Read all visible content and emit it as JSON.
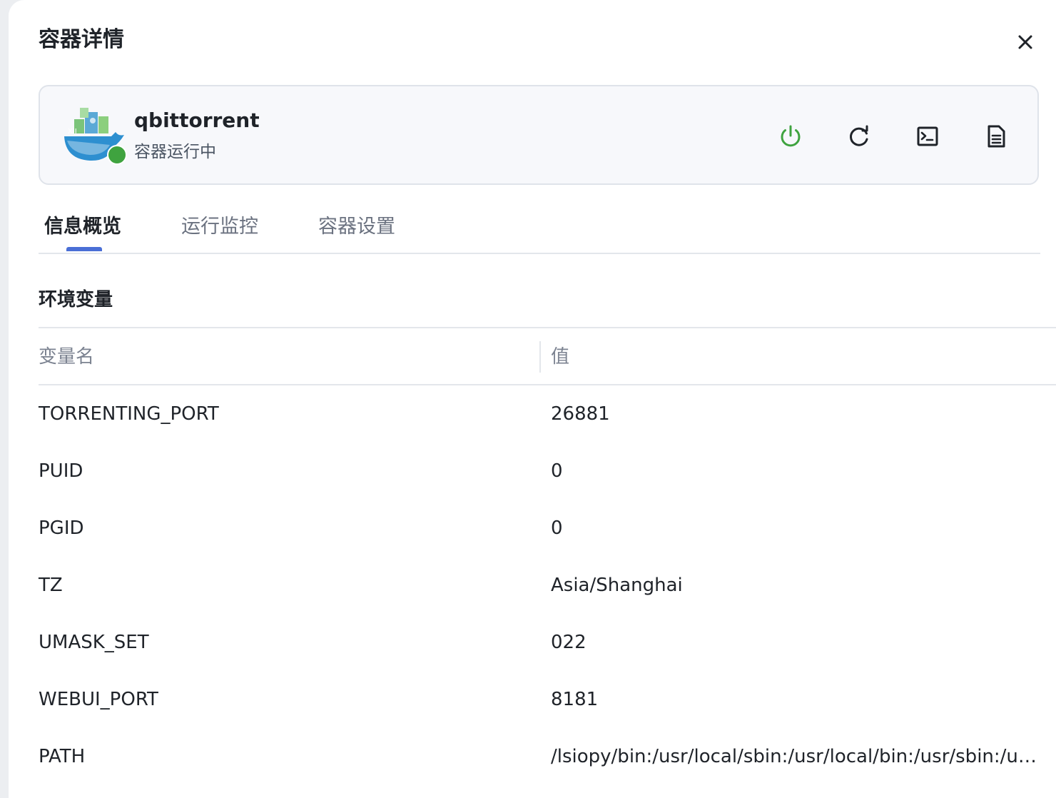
{
  "dialog": {
    "title": "容器详情"
  },
  "container": {
    "name": "qbittorrent",
    "status": "容器运行中",
    "status_color": "#3fa33f"
  },
  "actions": [
    {
      "icon": "power-icon",
      "color": "#3fa33f"
    },
    {
      "icon": "restart-icon",
      "color": "#1f2329"
    },
    {
      "icon": "terminal-icon",
      "color": "#1f2329"
    },
    {
      "icon": "log-document-icon",
      "color": "#1f2329"
    }
  ],
  "tabs": [
    {
      "label": "信息概览",
      "active": true
    },
    {
      "label": "运行监控",
      "active": false
    },
    {
      "label": "容器设置",
      "active": false
    }
  ],
  "env": {
    "section_title": "环境变量",
    "columns": {
      "name": "变量名",
      "value": "值"
    },
    "rows": [
      {
        "name": "TORRENTING_PORT",
        "value": "26881"
      },
      {
        "name": "PUID",
        "value": "0"
      },
      {
        "name": "PGID",
        "value": "0"
      },
      {
        "name": "TZ",
        "value": "Asia/Shanghai"
      },
      {
        "name": "UMASK_SET",
        "value": "022"
      },
      {
        "name": "WEBUI_PORT",
        "value": "8181"
      },
      {
        "name": "PATH",
        "value": "/lsiopy/bin:/usr/local/sbin:/usr/local/bin:/usr/sbin:/usr/bin:/sbin:/bin"
      }
    ]
  },
  "accent_color": "#4a6fd6"
}
